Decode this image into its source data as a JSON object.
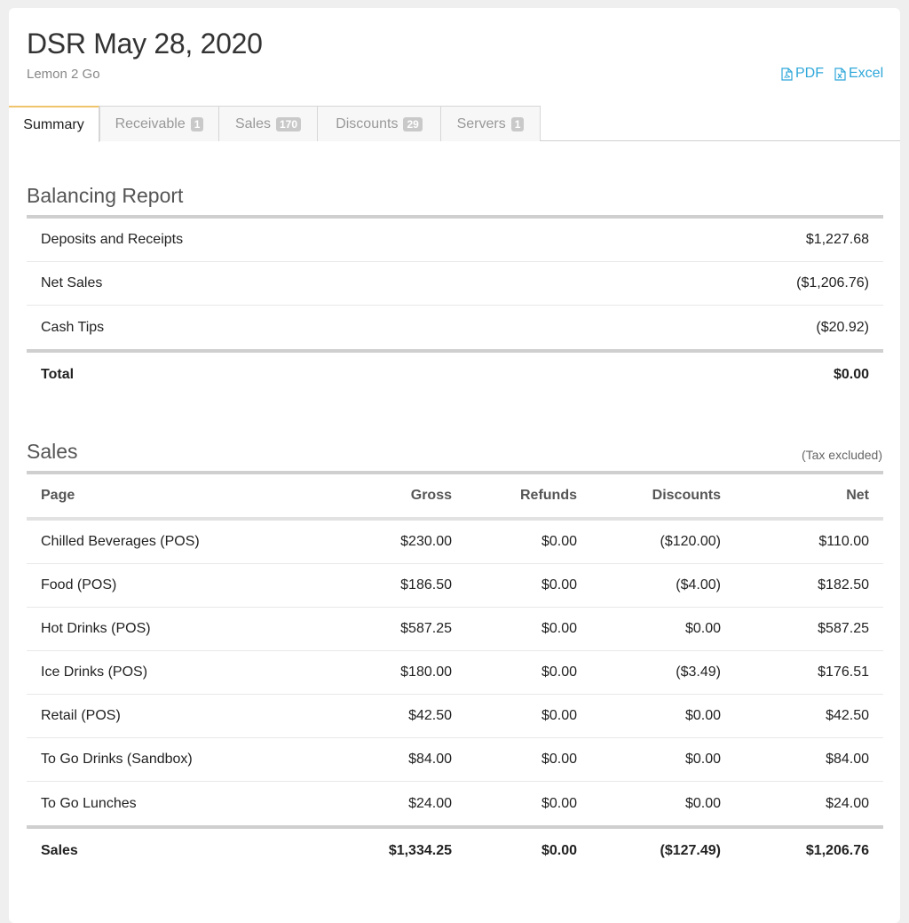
{
  "header": {
    "title": "DSR May 28, 2020",
    "subtitle": "Lemon 2 Go",
    "pdf_label": "PDF",
    "excel_label": "Excel"
  },
  "tabs": [
    {
      "label": "Summary",
      "badge": ""
    },
    {
      "label": "Receivable",
      "badge": "1"
    },
    {
      "label": "Sales",
      "badge": "170"
    },
    {
      "label": "Discounts",
      "badge": "29"
    },
    {
      "label": "Servers",
      "badge": "1"
    }
  ],
  "balancing": {
    "title": "Balancing Report",
    "rows": [
      {
        "label": "Deposits and Receipts",
        "value": "$1,227.68"
      },
      {
        "label": "Net Sales",
        "value": "($1,206.76)"
      },
      {
        "label": "Cash Tips",
        "value": "($20.92)"
      }
    ],
    "total": {
      "label": "Total",
      "value": "$0.00"
    }
  },
  "sales": {
    "title": "Sales",
    "note": "(Tax excluded)",
    "columns": [
      "Page",
      "Gross",
      "Refunds",
      "Discounts",
      "Net"
    ],
    "rows": [
      [
        "Chilled Beverages (POS)",
        "$230.00",
        "$0.00",
        "($120.00)",
        "$110.00"
      ],
      [
        "Food (POS)",
        "$186.50",
        "$0.00",
        "($4.00)",
        "$182.50"
      ],
      [
        "Hot Drinks (POS)",
        "$587.25",
        "$0.00",
        "$0.00",
        "$587.25"
      ],
      [
        "Ice Drinks (POS)",
        "$180.00",
        "$0.00",
        "($3.49)",
        "$176.51"
      ],
      [
        "Retail (POS)",
        "$42.50",
        "$0.00",
        "$0.00",
        "$42.50"
      ],
      [
        "To Go Drinks (Sandbox)",
        "$84.00",
        "$0.00",
        "$0.00",
        "$84.00"
      ],
      [
        "To Go Lunches",
        "$24.00",
        "$0.00",
        "$0.00",
        "$24.00"
      ]
    ],
    "total": [
      "Sales",
      "$1,334.25",
      "$0.00",
      "($127.49)",
      "$1,206.76"
    ]
  }
}
